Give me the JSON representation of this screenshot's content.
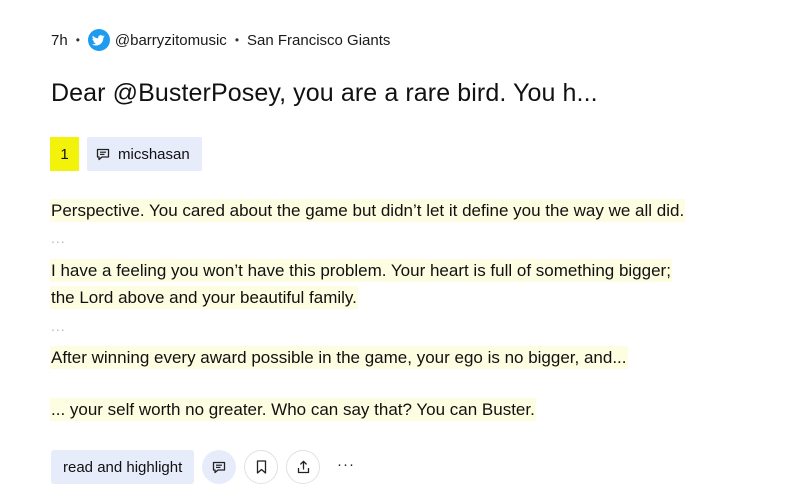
{
  "meta": {
    "time_ago": "7h",
    "handle": "@barryzitomusic",
    "team": "San Francisco Giants",
    "source_icon": "twitter-bird-icon"
  },
  "title": "Dear @BusterPosey, you are a rare bird. You h...",
  "highlight_count": "1",
  "highlighter": "micshasan",
  "highlights": [
    "Perspective. You cared about the game but didn’t let it define you the way we all did.",
    "I have a feeling you won’t have this problem. Your heart is full of something bigger;",
    "the Lord above and your beautiful family.",
    "After winning every award possible in the game, your ego is no bigger, and...",
    "... your self worth no greater. Who can say that? You can Buster."
  ],
  "ellipsis": "...",
  "actions": {
    "read_label": "read and highlight",
    "more_label": "···"
  },
  "colors": {
    "count_badge": "#f2f20a",
    "chip_bg": "#e7ecfb",
    "highlight_bg": "#fdfde1",
    "twitter_blue": "#1d9bf0"
  }
}
